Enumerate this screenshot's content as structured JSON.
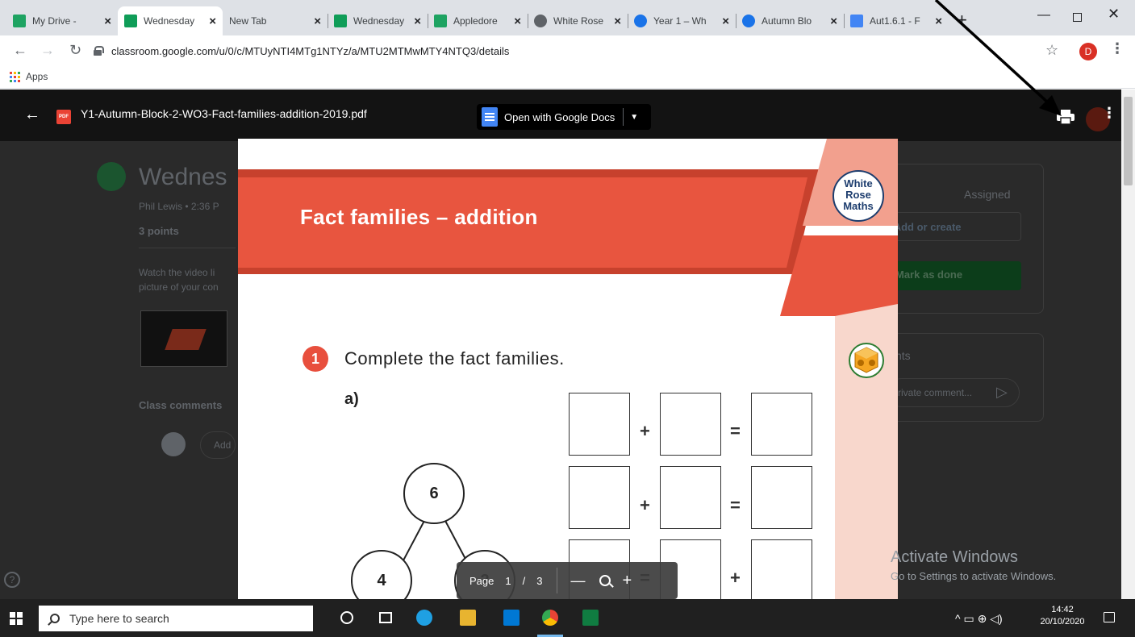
{
  "browser": {
    "tabs": [
      {
        "title": "My Drive - ",
        "color": "#1ea362",
        "active": false
      },
      {
        "title": "Wednesday",
        "color": "#0f9d58",
        "active": true
      },
      {
        "title": "New Tab",
        "color": "",
        "active": false
      },
      {
        "title": "Wednesday",
        "color": "#0f9d58",
        "active": false
      },
      {
        "title": "Appledore",
        "color": "#1ea362",
        "active": false
      },
      {
        "title": "White Rose",
        "color": "#5f6368",
        "active": false
      },
      {
        "title": "Year 1 – Wh",
        "color": "#1a73e8",
        "active": false
      },
      {
        "title": "Autumn Blo",
        "color": "#1a73e8",
        "active": false
      },
      {
        "title": "Aut1.6.1 - F",
        "color": "#4285f4",
        "active": false
      }
    ],
    "url": "classroom.google.com/u/0/c/MTUyNTI4MTg1NTYz/a/MTU2MTMwMTY4NTQ3/details",
    "profile_initial": "D",
    "bookmarks": {
      "apps_label": "Apps"
    }
  },
  "classroom": {
    "title": "Wednes",
    "meta": "Phil Lewis • 2:36 P",
    "points": "3 points",
    "desc1": "Watch the video li",
    "desc2": "picture of your con",
    "class_comments": "Class comments",
    "add_comment": "Add",
    "assigned": "Assigned",
    "add_create": "+ Add or create",
    "mark_done": "Mark as done",
    "private_comments": "nts",
    "private_placeholder": "rivate comment..."
  },
  "viewer": {
    "filename": "Y1-Autumn-Block-2-WO3-Fact-families-addition-2019.pdf",
    "open_with": "Open with Google Docs",
    "page_label": "Page",
    "page_current": "1",
    "page_sep": "/",
    "page_total": "3"
  },
  "worksheet": {
    "title": "Fact families – addition",
    "logo_line1": "White",
    "logo_line2": "Rose",
    "logo_line3": "Maths",
    "question_number": "1",
    "question_text": "Complete the fact families.",
    "part": "a)",
    "tree": {
      "top": "6",
      "left": "4",
      "right": "2"
    },
    "rows": [
      {
        "op1": "+",
        "op2": "="
      },
      {
        "op1": "+",
        "op2": "="
      },
      {
        "op1": "=",
        "op2": "+"
      }
    ],
    "colors": {
      "banner": "#e8553f",
      "banner_dark": "#c7412d",
      "sidebar": "#f8d7cc",
      "logo_navy": "#1d3d6e"
    }
  },
  "watermark": {
    "line1": "Activate Windows",
    "line2": "Go to Settings to activate Windows."
  },
  "taskbar": {
    "search_placeholder": "Type here to search",
    "time": "14:42",
    "date": "20/10/2020"
  }
}
